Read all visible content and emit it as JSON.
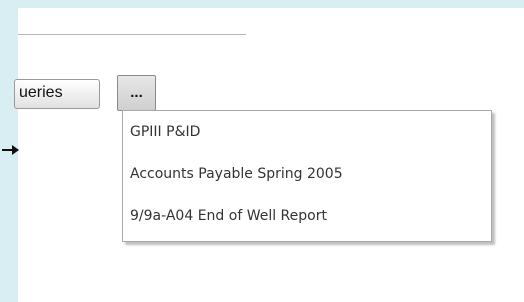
{
  "toolbar": {
    "queries_label": "ueries",
    "more_label": "..."
  },
  "dropdown": {
    "items": [
      {
        "label": "GPIII P&ID"
      },
      {
        "label": "Accounts Payable Spring 2005"
      },
      {
        "label": "9/9a-A04 End of Well Report"
      }
    ]
  },
  "colors": {
    "page_background": "#d9eef3",
    "panel_background": "#ffffff",
    "menu_text": "#333333"
  }
}
